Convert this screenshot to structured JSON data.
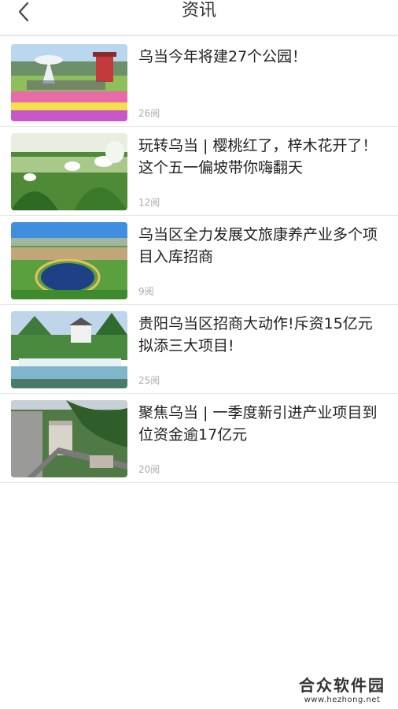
{
  "header": {
    "title": "资讯",
    "back_icon": "chevron-left-icon"
  },
  "news": [
    {
      "title": "乌当今年将建27个公园！",
      "reads": "26阅"
    },
    {
      "title": "玩转乌当 | 樱桃红了，梓木花开了！这个五一偏坡带你嗨翻天",
      "reads": "12阅"
    },
    {
      "title": "乌当区全力发展文旅康养产业多个项目入库招商",
      "reads": "9阅"
    },
    {
      "title": "贵阳乌当区招商大动作!斥资15亿元拟添三大项目!",
      "reads": "25阅"
    },
    {
      "title": "聚焦乌当 | 一季度新引进产业项目到位资金逾17亿元",
      "reads": "20阅"
    }
  ],
  "watermark": {
    "name": "合众软件园",
    "url": "www.hezhong.net"
  },
  "colors": {
    "divider": "#e8e8e8",
    "reads_text": "#aaaaaa",
    "title_text": "#222222"
  }
}
